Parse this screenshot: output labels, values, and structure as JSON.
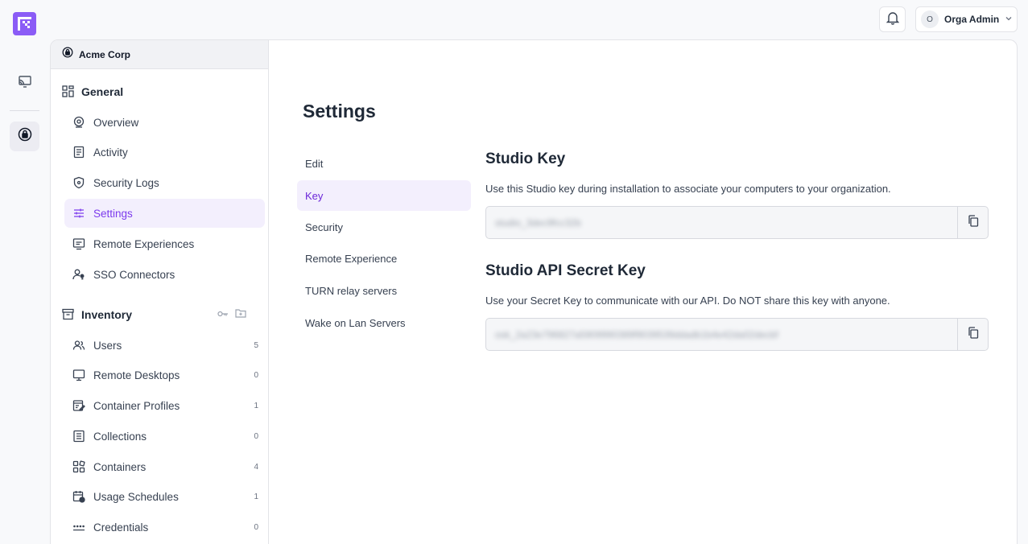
{
  "topbar": {
    "user_initial": "O",
    "user_name": "Orga Admin"
  },
  "org": {
    "name": "Acme Corp"
  },
  "sidebar": {
    "general_label": "General",
    "general_items": [
      {
        "label": "Overview"
      },
      {
        "label": "Activity"
      },
      {
        "label": "Security Logs"
      },
      {
        "label": "Settings"
      },
      {
        "label": "Remote Experiences"
      },
      {
        "label": "SSO Connectors"
      }
    ],
    "inventory_label": "Inventory",
    "inventory_items": [
      {
        "label": "Users",
        "count": "5"
      },
      {
        "label": "Remote Desktops",
        "count": "0"
      },
      {
        "label": "Container Profiles",
        "count": "1"
      },
      {
        "label": "Collections",
        "count": "0"
      },
      {
        "label": "Containers",
        "count": "4"
      },
      {
        "label": "Usage Schedules",
        "count": "1"
      },
      {
        "label": "Credentials",
        "count": "0"
      }
    ]
  },
  "main": {
    "title": "Settings",
    "subnav": [
      {
        "label": "Edit"
      },
      {
        "label": "Key"
      },
      {
        "label": "Security"
      },
      {
        "label": "Remote Experience"
      },
      {
        "label": "TURN relay servers"
      },
      {
        "label": "Wake on Lan Servers"
      }
    ],
    "studio_key": {
      "title": "Studio Key",
      "description": "Use this Studio key during installation to associate your computers to your organization.",
      "value": "studio_3dec9fcc32b"
    },
    "api_key": {
      "title": "Studio API Secret Key",
      "description": "Use your Secret Key to communicate with our API. Do NOT share this key with anyone.",
      "value": "osk_2a23e796827a5909990389f9039539ddadb1b4e42da02decbf"
    }
  },
  "colors": {
    "accent": "#8b5cf6",
    "active_bg": "#f3effd",
    "active_text": "#7c3aed"
  }
}
